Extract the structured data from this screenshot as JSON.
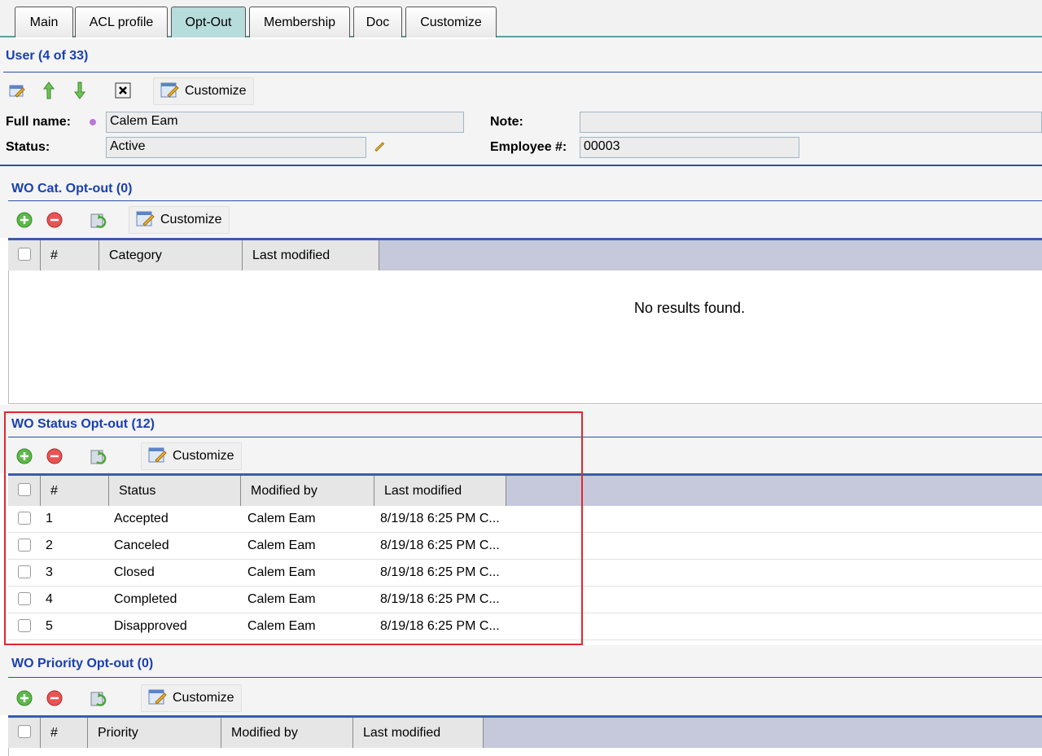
{
  "tabs": [
    "Main",
    "ACL profile",
    "Opt-Out",
    "Membership",
    "Doc",
    "Customize"
  ],
  "active_tab": "Opt-Out",
  "record": {
    "title": "User (4 of 33)",
    "customize_label": "Customize",
    "full_name_label": "Full name:",
    "full_name_value": "Calem Eam",
    "status_label": "Status:",
    "status_value": "Active",
    "note_label": "Note:",
    "note_value": "",
    "employee_label": "Employee #:",
    "employee_value": "00003"
  },
  "cat_section": {
    "title": "WO Cat. Opt-out (0)",
    "customize_label": "Customize",
    "columns": [
      "#",
      "Category",
      "Last modified"
    ],
    "empty_text": "No results found."
  },
  "status_section": {
    "title": "WO Status Opt-out (12)",
    "customize_label": "Customize",
    "columns": [
      "#",
      "Status",
      "Modified by",
      "Last modified"
    ],
    "rows": [
      {
        "num": "1",
        "status": "Accepted",
        "by": "Calem Eam",
        "modified": "8/19/18 6:25 PM C..."
      },
      {
        "num": "2",
        "status": "Canceled",
        "by": "Calem Eam",
        "modified": "8/19/18 6:25 PM C..."
      },
      {
        "num": "3",
        "status": "Closed",
        "by": "Calem Eam",
        "modified": "8/19/18 6:25 PM C..."
      },
      {
        "num": "4",
        "status": "Completed",
        "by": "Calem Eam",
        "modified": "8/19/18 6:25 PM C..."
      },
      {
        "num": "5",
        "status": "Disapproved",
        "by": "Calem Eam",
        "modified": "8/19/18 6:25 PM C..."
      }
    ]
  },
  "priority_section": {
    "title": "WO Priority Opt-out (0)",
    "customize_label": "Customize",
    "columns": [
      "#",
      "Priority",
      "Modified by",
      "Last modified"
    ]
  },
  "colors": {
    "title_blue": "#1a40b0",
    "highlight_red": "#e0282e",
    "grid_header": "#c5c9db",
    "active_tab": "#b7dcdc"
  }
}
